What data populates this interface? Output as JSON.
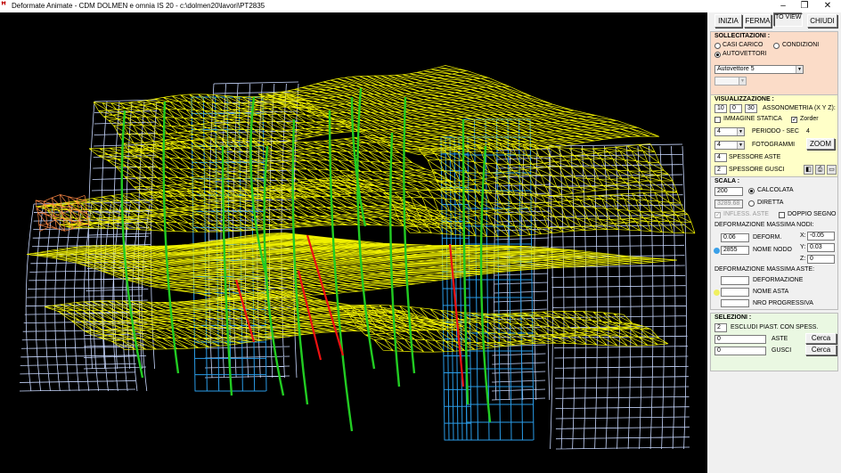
{
  "window": {
    "title": "Deformate Animate - CDM DOLMEN e omnia IS 20 - c:\\dolmen20\\lavori\\PT2835",
    "app_icon": "dolmen-logo-icon",
    "controls": {
      "minimize": "–",
      "maximize": "❐",
      "close": "✕"
    }
  },
  "toolbar": {
    "start_label": "INIZIA",
    "stop_label": "FERMA",
    "toview_label": "TO VIEW Zx",
    "close_label": "CHIUDI"
  },
  "sollecitazioni": {
    "heading": "SOLLECITAZIONI :",
    "opt_casi": "CASI CARICO",
    "opt_condizioni": "CONDIZIONI",
    "opt_autovettori": "AUTOVETTORI",
    "selected": "AUTOVETTORI",
    "combo_value": "Autovettore 5",
    "combo2_value": "",
    "bg_color": "#fbdcc8"
  },
  "visualizzazione": {
    "heading": "VISUALIZZAZIONE :",
    "x": "10",
    "y": "0",
    "z": "30",
    "assonometria_label": "ASSONOMETRIA (X Y Z):",
    "immagine_statica_label": "IMMAGINE STATICA",
    "immagine_statica_checked": false,
    "zorder_label": "Zorder",
    "zorder_checked": true,
    "periodo_value": "4",
    "periodo_label": "PERIODO - SEC",
    "periodo_sec": "4",
    "fotogrammi_value": "4",
    "fotogrammi_label": "FOTOGRAMMI",
    "zoom_label": "ZOOM",
    "spessore_aste_value": "4",
    "spessore_aste_label": "SPESSORE ASTE",
    "spessore_gusci_value": "2",
    "spessore_gusci_label": "SPESSORE GUSCI",
    "bg_color": "#ffffc8"
  },
  "scala": {
    "heading": "SCALA :",
    "scala_value": "200",
    "calcolata_label": "CALCOLATA",
    "diretta_value": "3289.68",
    "diretta_label": "DIRETTA",
    "selected": "CALCOLATA",
    "infless_label": "INFLESS. ASTE",
    "doppio_label": "DOPPIO SEGNO",
    "def_nodi_label": "DEFORMAZIONE MASSIMA NODI:",
    "deform_value": "0.06",
    "deform_label": "DEFORM.",
    "nome_nodo_value": "2855",
    "nome_nodo_label": "NOME NODO",
    "x_label": "X:",
    "x_value": "-0.05",
    "y_label": "Y:",
    "y_value": "0.03",
    "z_label": "Z:",
    "z_value": "0",
    "def_aste_label": "DEFORMAZIONE MASSIMA ASTE:",
    "aste_deform_value": "",
    "aste_deform_label": "DEFORMAZIONE",
    "nome_asta_value": "",
    "nome_asta_label": "NOME ASTA",
    "nro_value": "",
    "nro_label": "NRO PROGRESSIVA",
    "nodo_marker_color": "#3aa0e8",
    "asta_marker_color": "#f0f060"
  },
  "selezioni": {
    "heading": "SELEZIONI :",
    "escludi_value": "2",
    "escludi_label": "ESCLUDI PIAST. CON SPESS.",
    "aste_value": "0",
    "aste_label": "ASTE",
    "gusci_value": "0",
    "gusci_label": "GUSCI",
    "cerca_label": "Cerca",
    "bg_color": "#eaf8e2"
  },
  "colors": {
    "slab": "#f0f000",
    "column": "#22cc22",
    "wall": "#2a9ce8",
    "facade": "#c8d8ff",
    "brace": "#ee1111",
    "orange_slab": "#ff8844"
  }
}
